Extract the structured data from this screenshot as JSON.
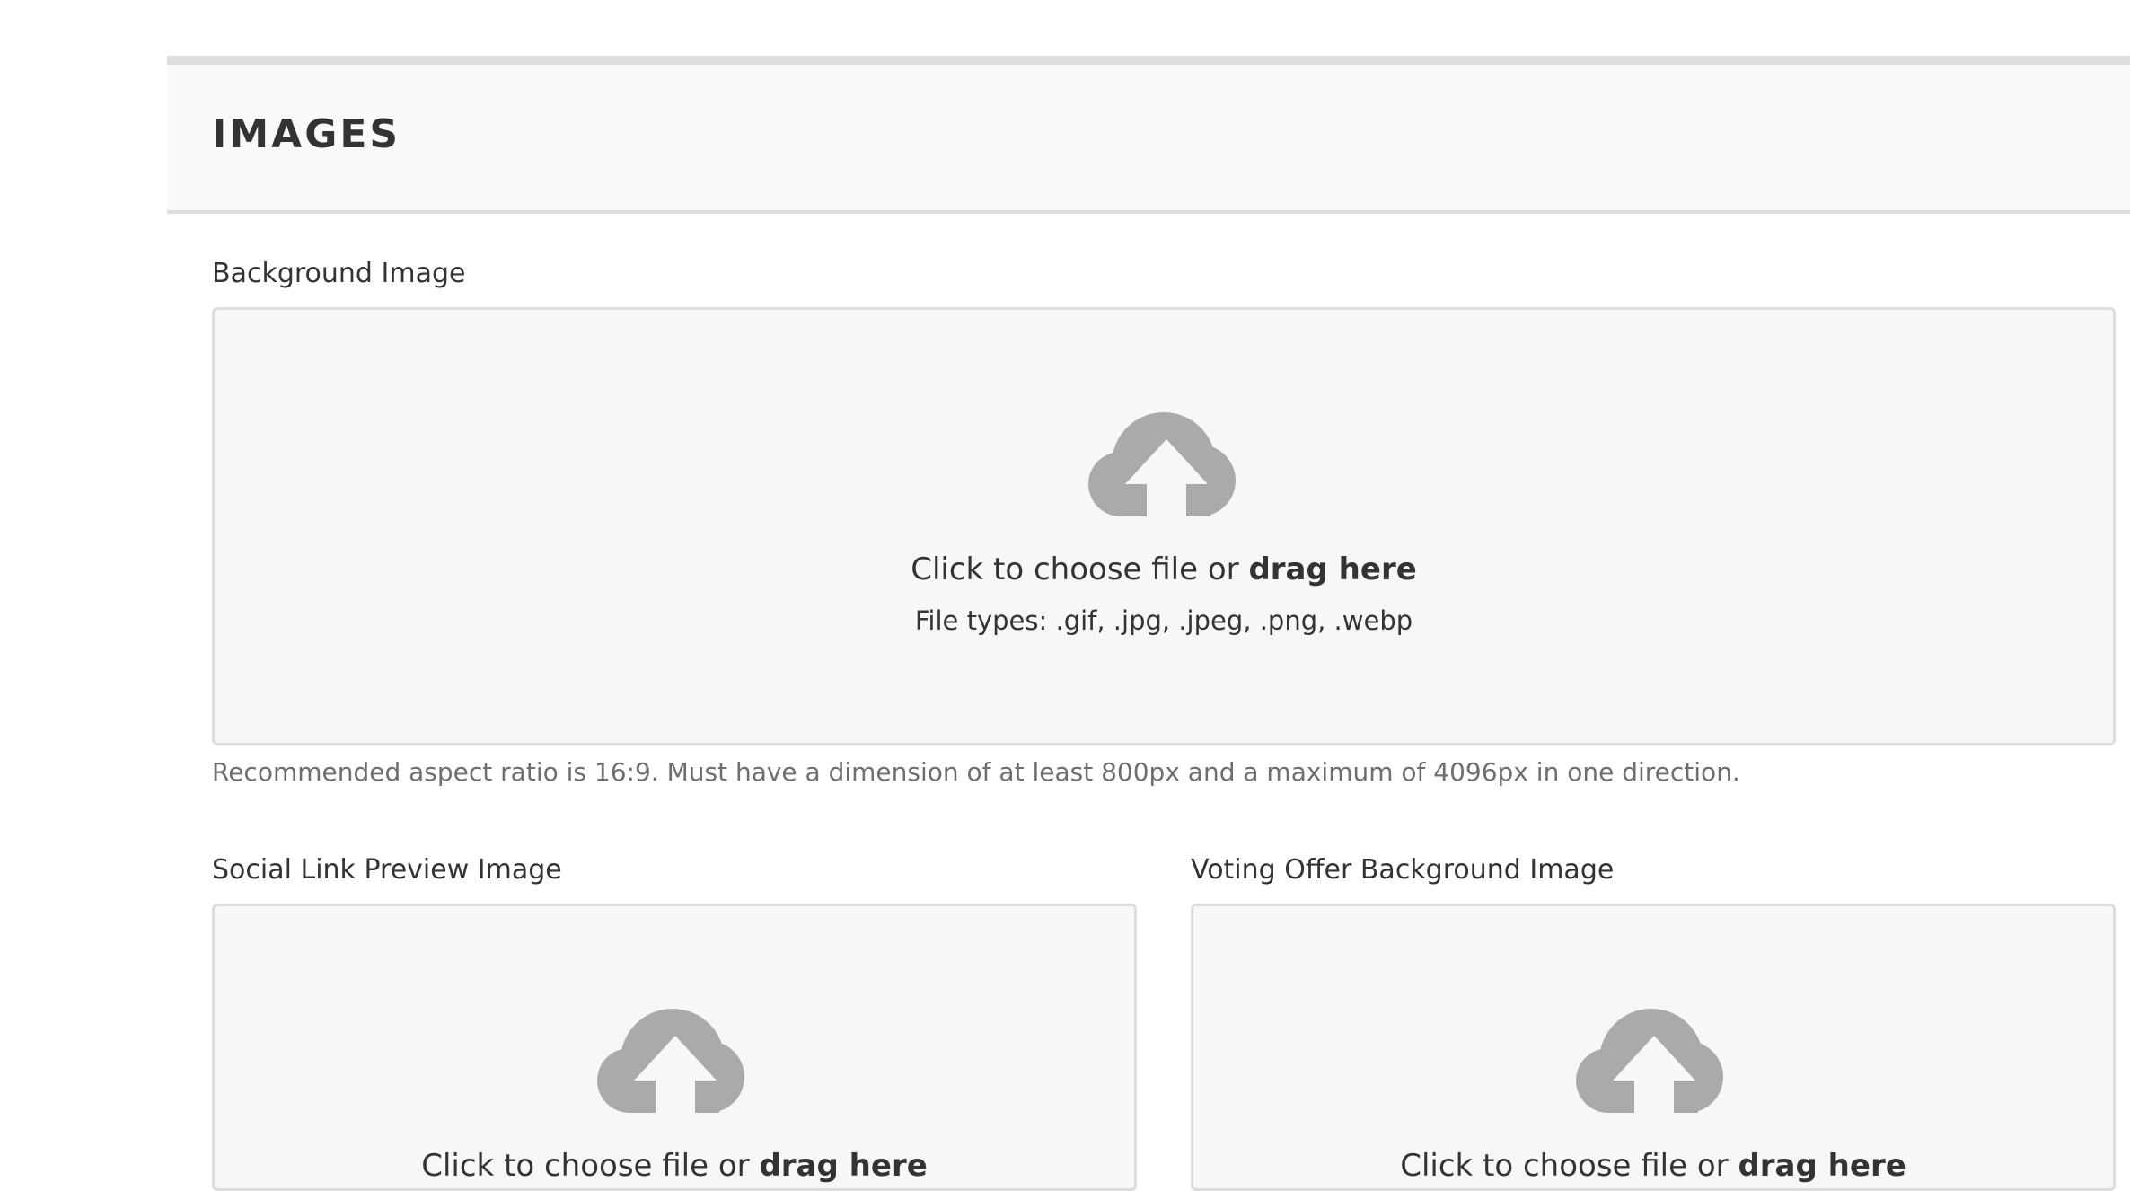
{
  "section": {
    "title": "IMAGES"
  },
  "background_image": {
    "label": "Background Image",
    "dropzone": {
      "prompt_prefix": "Click to choose file or ",
      "prompt_bold": "drag here",
      "file_types": "File types: .gif, .jpg, .jpeg, .png, .webp"
    },
    "help": "Recommended aspect ratio is 16:9. Must have a dimension of at least 800px and a maximum of 4096px in one direction."
  },
  "social_preview_image": {
    "label": "Social Link Preview Image",
    "dropzone": {
      "prompt_prefix": "Click to choose file or ",
      "prompt_bold": "drag here"
    }
  },
  "voting_offer_background_image": {
    "label": "Voting Offer Background Image",
    "dropzone": {
      "prompt_prefix": "Click to choose file or ",
      "prompt_bold": "drag here"
    }
  },
  "icons": {
    "upload": "cloud-upload-icon"
  },
  "colors": {
    "icon_gray": "#aaaaaa",
    "dropzone_bg": "#f7f7f7",
    "border": "#dddddd",
    "help_text": "#6b6f73"
  }
}
